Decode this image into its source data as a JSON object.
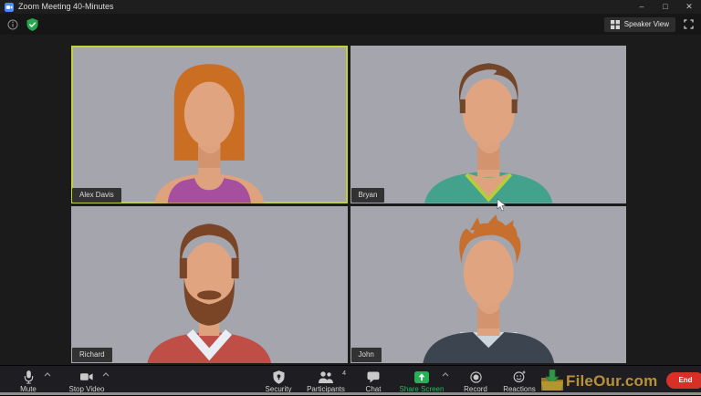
{
  "titlebar": {
    "title": "Zoom Meeting 40-Minutes",
    "controls": {
      "minimize": "–",
      "maximize": "□",
      "close": "✕"
    }
  },
  "header": {
    "speaker_view_label": "Speaker View"
  },
  "tiles": [
    {
      "name": "Alex Davis",
      "active": true
    },
    {
      "name": "Bryan",
      "active": false
    },
    {
      "name": "Richard",
      "active": false
    },
    {
      "name": "John",
      "active": false
    }
  ],
  "toolbar": {
    "mute_label": "Mute",
    "stop_video_label": "Stop Video",
    "security_label": "Security",
    "participants_label": "Participants",
    "participants_count": "4",
    "chat_label": "Chat",
    "share_screen_label": "Share Screen",
    "record_label": "Record",
    "reactions_label": "Reactions",
    "end_label": "End"
  },
  "watermark": {
    "text": "FileOur.com"
  },
  "colors": {
    "zoom_blue": "#4a8cff",
    "shield_green": "#27a64e",
    "share_green": "#2db85c",
    "active_border": "#c1d23c",
    "end_red": "#d73027",
    "watermark_gold": "#c79b3b"
  }
}
